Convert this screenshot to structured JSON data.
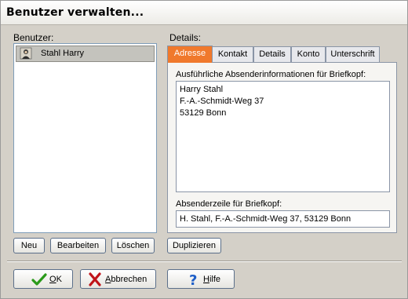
{
  "window": {
    "title": "Benutzer verwalten..."
  },
  "users": {
    "label": "Benutzer:",
    "items": [
      {
        "name": "Stahl Harry"
      }
    ]
  },
  "details": {
    "label": "Details:",
    "tabs": [
      {
        "label": "Adresse",
        "active": true
      },
      {
        "label": "Kontakt",
        "active": false
      },
      {
        "label": "Details",
        "active": false
      },
      {
        "label": "Konto",
        "active": false
      },
      {
        "label": "Unterschrift",
        "active": false
      }
    ],
    "address_label": "Ausführliche Absenderinformationen für Briefkopf:",
    "address_lines": [
      "Harry Stahl",
      "F.-A.-Schmidt-Weg 37",
      "53129 Bonn"
    ],
    "sender_label": "Absenderzeile für Briefkopf:",
    "sender_value": "H. Stahl, F.-A.-Schmidt-Weg 37, 53129 Bonn"
  },
  "buttons": {
    "new": "Neu",
    "edit": "Bearbeiten",
    "delete": "Löschen",
    "duplicate": "Duplizieren",
    "ok_hotkey": "O",
    "ok_rest": "K",
    "cancel_hotkey": "A",
    "cancel_rest": "bbrechen",
    "help_hotkey": "H",
    "help_rest": "ilfe"
  },
  "icons": {
    "ok": "check-icon",
    "cancel": "x-icon",
    "help": "question-icon",
    "user": "user-avatar-icon"
  },
  "colors": {
    "active_tab": "#f0792c",
    "ok_check": "#2a9a1a",
    "cancel_x": "#c0141a",
    "help_q": "#1f5fc8"
  }
}
